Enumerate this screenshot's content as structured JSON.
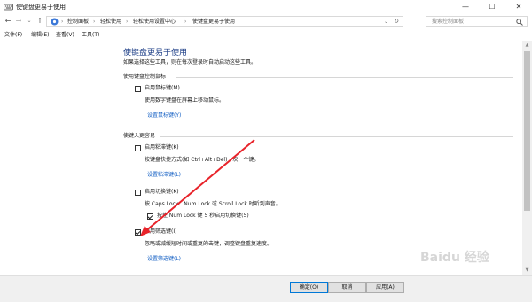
{
  "window": {
    "title": "使键盘更易于使用",
    "minimize": "—",
    "maximize": "☐",
    "close": "✕",
    "accent_color": "#0078d7"
  },
  "nav": {
    "back": "←",
    "forward": "→",
    "recent": "⌄",
    "up": "↑",
    "breadcrumbs": [
      "控制面板",
      "轻松使用",
      "轻松使用设置中心",
      "使键盘更易于使用"
    ],
    "separator": "›",
    "dropdown": "⌄",
    "refresh": "↻",
    "search_placeholder": "搜索控制面板"
  },
  "menu": {
    "items": [
      "文件(F)",
      "编辑(E)",
      "查看(V)",
      "工具(T)"
    ]
  },
  "page": {
    "title": "使键盘更易于使用",
    "subtitle": "如果选择这些工具，则在每次登录时自动启动这些工具。",
    "section_mouse": {
      "heading": "使用键盘控制鼠标",
      "mousekeys_label": "启用鼠标键(M)",
      "mousekeys_checked": false,
      "mousekeys_desc": "使用数字键盘在屏幕上移动鼠标。",
      "mousekeys_link": "设置鼠标键(Y)"
    },
    "section_typing": {
      "heading": "使键入更容易",
      "stickykeys_label": "启用粘滞键(K)",
      "stickykeys_checked": false,
      "stickykeys_desc": "按键盘快捷方式(如 Ctrl+Alt+Del)一次一个键。",
      "stickykeys_link": "设置粘滞键(L)",
      "togglekeys_label": "启用切换键(K)",
      "togglekeys_checked": false,
      "togglekeys_desc": "按 Caps Lock、Num Lock 或 Scroll Lock 时听到声音。",
      "togglekeys_hold_label": "按住 Num Lock 键 5 秒启用切换键(5)",
      "togglekeys_hold_checked": true,
      "filterkeys_label": "启用筛选键(I)",
      "filterkeys_checked": true,
      "filterkeys_desc": "忽略或减缓短时间或重复的击键，调整键盘重复速度。",
      "filterkeys_link": "设置筛选键(L)"
    }
  },
  "footer": {
    "ok": "确定(O)",
    "cancel": "取消",
    "apply": "应用(A)"
  },
  "annotation": {
    "arrow_color": "#e8232a"
  },
  "watermark": "Baidu 经验"
}
